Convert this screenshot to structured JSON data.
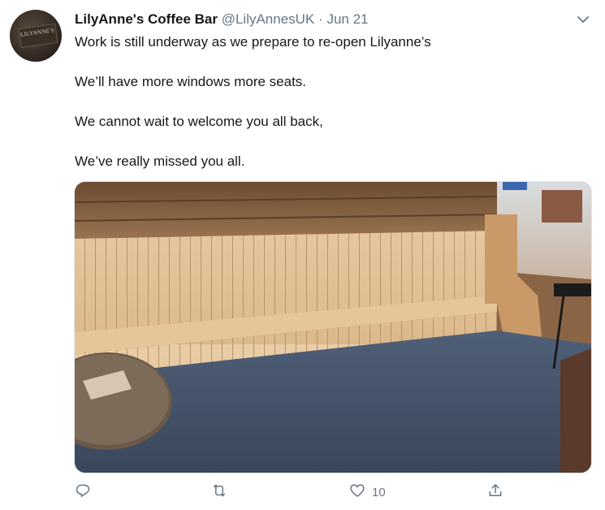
{
  "tweet": {
    "display_name": "LilyAnne's Coffee Bar",
    "handle": "@LilyAnnesUK",
    "separator": "·",
    "date": "Jun 21",
    "avatar_text": "LILYANNE'S",
    "lines": [
      "Work is still underway as we prepare to re-open Lilyanne’s",
      "We’ll have more windows more seats.",
      "We cannot wait to welcome you all back,",
      "We’ve really missed you all."
    ],
    "likes_count": "10"
  },
  "icons": {
    "more": "chevron-down-icon",
    "reply": "reply-icon",
    "retweet": "retweet-icon",
    "like": "heart-icon",
    "share": "share-icon"
  },
  "colors": {
    "text": "#14171a",
    "secondary": "#657786",
    "border": "#e1e8ed"
  }
}
